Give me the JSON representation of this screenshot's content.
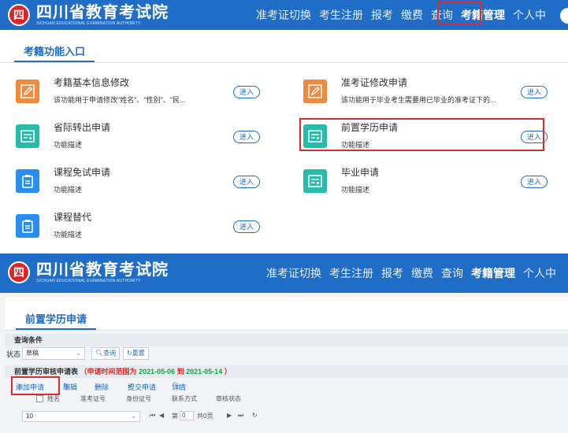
{
  "brand": {
    "logo_glyph": "四",
    "name_cn": "四川省教育考试院",
    "name_en": "SICHUAN EDUCATIONAL EXAMINATION AUTHORITY",
    "header_color": "#1f6dc7",
    "logo_color": "#d8262b"
  },
  "top_screen": {
    "nav": [
      "准考证切换",
      "考生注册",
      "报考",
      "缴费",
      "查询",
      "考籍管理",
      "个人中"
    ],
    "active_nav_index": 5,
    "tab": "考籍功能入口",
    "items": [
      {
        "title": "考籍基本信息修改",
        "desc": "该功能用于申请修改\"姓名\"、\"性别\"、\"民...",
        "enter": "进入",
        "icon": "edit-icon",
        "color": "#f2893c"
      },
      {
        "title": "准考证修改申请",
        "desc": "该功能用于毕业考生需要用已毕业的准考证下的...",
        "enter": "进入",
        "icon": "edit-icon",
        "color": "#f2893c"
      },
      {
        "title": "省际转出申请",
        "desc": "功能描述",
        "enter": "进入",
        "icon": "certificate-icon",
        "color": "#26bcaa"
      },
      {
        "title": "前置学历申请",
        "desc": "功能描述",
        "enter": "进入",
        "icon": "certificate-icon",
        "color": "#26bcaa"
      },
      {
        "title": "课程免试申请",
        "desc": "功能描述",
        "enter": "进入",
        "icon": "clipboard-icon",
        "color": "#2a8ef0"
      },
      {
        "title": "毕业申请",
        "desc": "功能描述",
        "enter": "进入",
        "icon": "certificate-icon",
        "color": "#26bcaa"
      },
      {
        "title": "课程替代",
        "desc": "功能描述",
        "enter": "进入",
        "icon": "clipboard-icon",
        "color": "#2a8ef0"
      }
    ]
  },
  "bottom_screen": {
    "nav": [
      "准考证切换",
      "考生注册",
      "报考",
      "缴费",
      "查询",
      "考籍管理",
      "个人中"
    ],
    "active_nav_index": 5,
    "tab": "前置学历申请",
    "query_section": "查询条件",
    "status_label": "状态",
    "status_value": "草稿",
    "query_btn": "查询",
    "reset_btn": "重置",
    "table_title": "前置学历审核申请表",
    "range_prefix": "（申请时间范围为",
    "range_start": "2021-05-06",
    "range_to": "到",
    "range_end": "2021-05-14",
    "range_suffix": "）",
    "toolbar": {
      "add": "添加申请",
      "edit": "编辑",
      "delete": "删除",
      "submit": "提交申请",
      "detail": "详情"
    },
    "columns": [
      "姓名",
      "准考证号",
      "身份证号",
      "联系方式",
      "审核状态"
    ],
    "pager": {
      "page_size": "10",
      "first": "⏮",
      "prev": "◀",
      "page_prefix": "第",
      "page": "0",
      "page_total": "共0页",
      "next": "▶",
      "last": "⏭",
      "refresh": "↻"
    }
  }
}
